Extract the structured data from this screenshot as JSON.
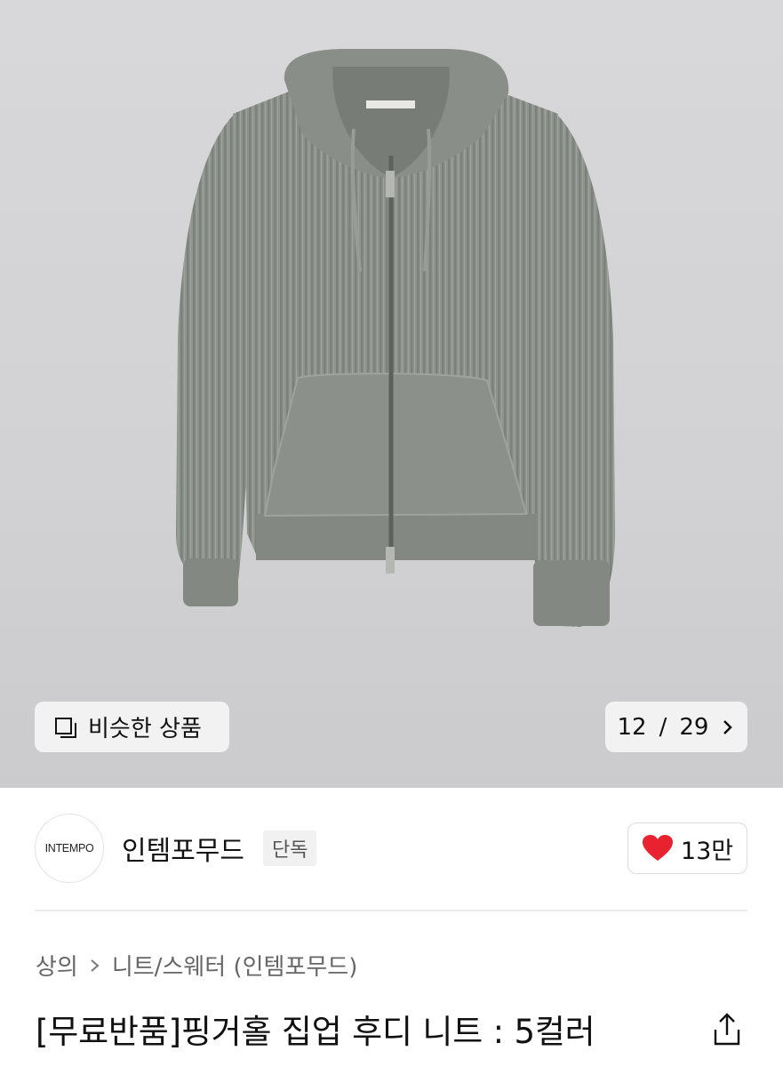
{
  "gallery": {
    "similar_label": "비슷한 상품",
    "current": "12",
    "separator": "/",
    "total": "29",
    "next_icon": "chevron-right-icon"
  },
  "brand": {
    "logo_text": "INTEMPO",
    "name": "인템포무드",
    "badge": "단독",
    "likes": "13만",
    "like_color": "#e8222e"
  },
  "breadcrumb": {
    "category": "상의",
    "subcategory": "니트/스웨터 (인템포무드)"
  },
  "product": {
    "title": "[무료반품]핑거홀 집업 후디 니트 : 5컬러",
    "color": "#8e928c"
  }
}
